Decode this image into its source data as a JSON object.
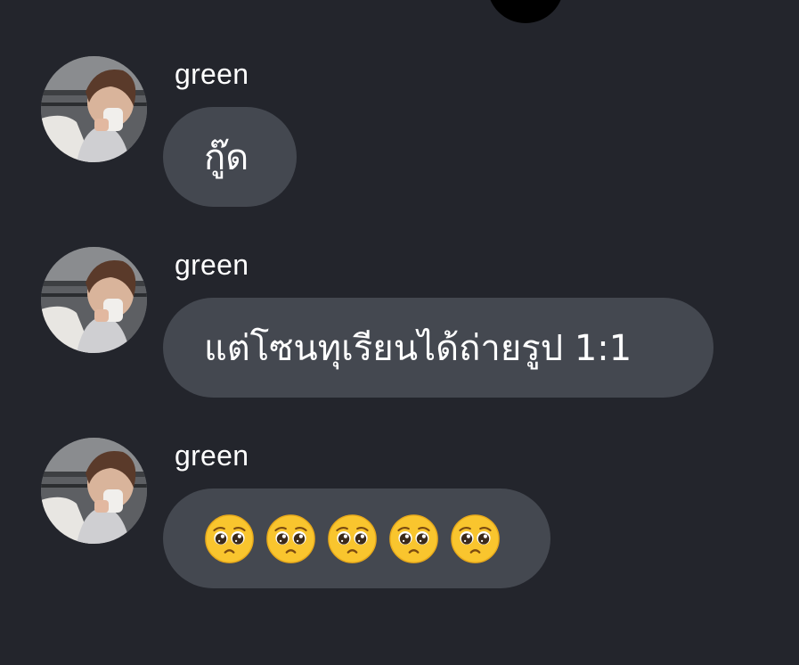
{
  "messages": [
    {
      "sender": "green",
      "text": "กู๊ด"
    },
    {
      "sender": "green",
      "text": "แต่โซนทุเรียนได้ถ่ายรูป 1:1"
    },
    {
      "sender": "green",
      "emojis": [
        "pleading-face",
        "pleading-face",
        "pleading-face",
        "pleading-face",
        "pleading-face"
      ]
    }
  ],
  "colors": {
    "background": "#23252c",
    "bubble": "#444850",
    "text": "#ffffff"
  }
}
